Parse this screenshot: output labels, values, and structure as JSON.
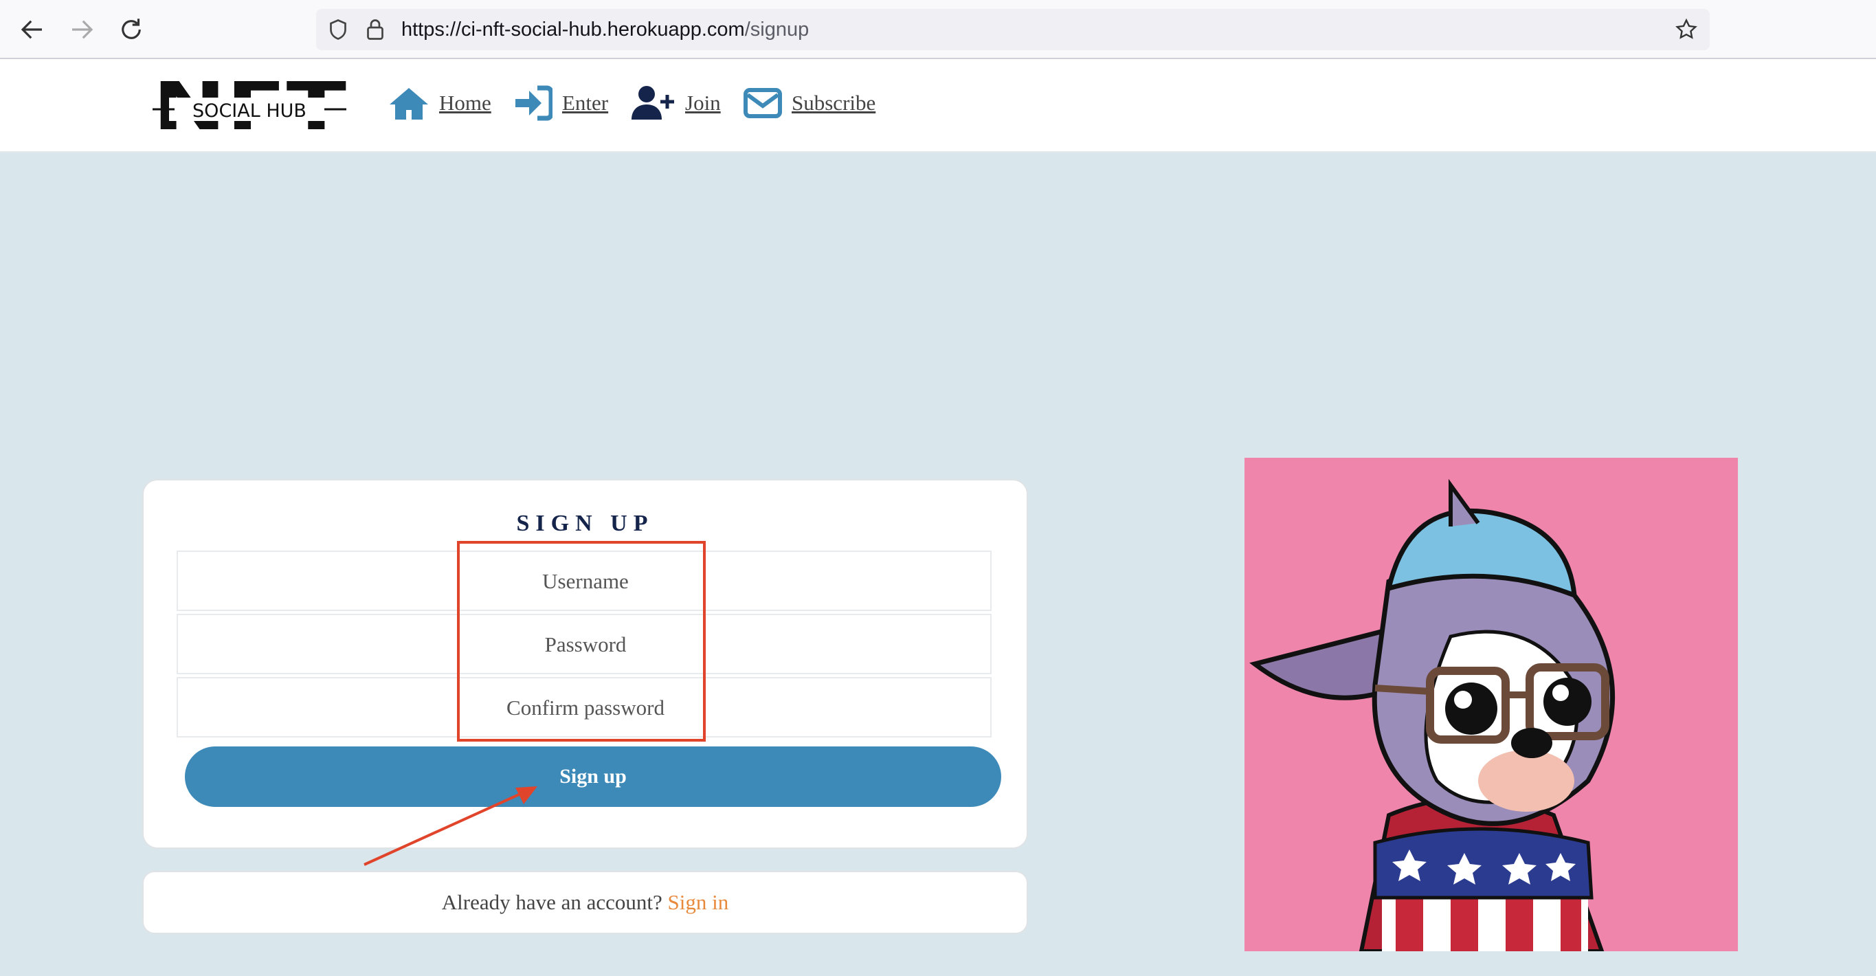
{
  "browser": {
    "url_host": "https://ci-nft-social-hub.herokuapp.com",
    "url_path": "/signup",
    "icons": [
      "back-arrow-icon",
      "forward-arrow-icon",
      "reload-icon",
      "shield-icon",
      "lock-icon",
      "star-icon"
    ]
  },
  "header": {
    "logo_text_big": "NFT",
    "logo_text_small": "SOCIAL HUB",
    "nav": [
      {
        "label": "Home",
        "icon": "home-icon"
      },
      {
        "label": "Enter",
        "icon": "sign-in-icon"
      },
      {
        "label": "Join",
        "icon": "user-plus-icon"
      },
      {
        "label": "Subscribe",
        "icon": "envelope-icon"
      }
    ]
  },
  "signup": {
    "title": "SIGN UP",
    "username_placeholder": "Username",
    "password_placeholder": "Password",
    "confirm_placeholder": "Confirm password",
    "button_label": "Sign up"
  },
  "signin": {
    "prompt": "Already have an account?",
    "link_label": "Sign in"
  },
  "colors": {
    "page_bg": "#d9e6ec",
    "primary_button": "#3d8ab9",
    "link_accent": "#e8893c",
    "nav_icon_blue": "#3d8ab9",
    "nav_icon_navy": "#14244a",
    "annotation_red": "#e0452c",
    "nft_bg": "#ef85ab"
  }
}
